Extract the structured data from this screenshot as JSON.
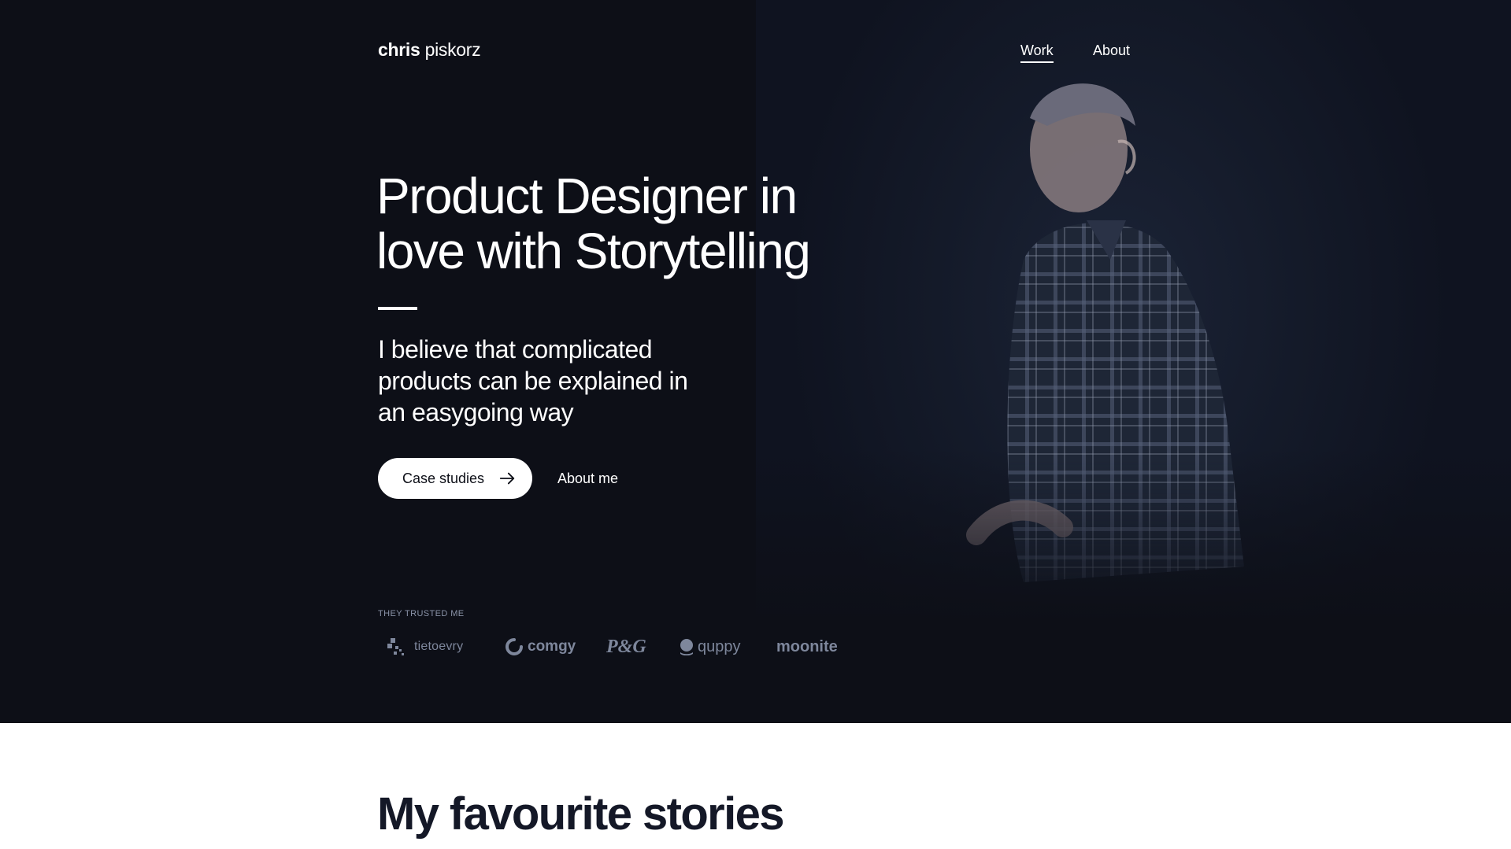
{
  "header": {
    "brand_first": "chris",
    "brand_last": "piskorz",
    "nav": {
      "work": "Work",
      "about": "About"
    }
  },
  "hero": {
    "headline_line1": "Product Designer in",
    "headline_line2": "love with Storytelling",
    "lead_line1": "I believe that complicated",
    "lead_line2": "products can be explained in",
    "lead_line3": "an easygoing way",
    "primary_button": "Case studies",
    "primary_button_icon": "arrow-right-icon",
    "secondary_button": "About me"
  },
  "trusted": {
    "label": "THEY TRUSTED ME",
    "logos": [
      "tietoevry",
      "comgy",
      "P&G",
      "quppy",
      "moonite"
    ]
  },
  "stories": {
    "title": "My favourite stories"
  },
  "colors": {
    "hero_background": "#0d0f17",
    "logo_gray": "#7e879c",
    "white": "#ffffff",
    "dark_text": "#141827"
  }
}
